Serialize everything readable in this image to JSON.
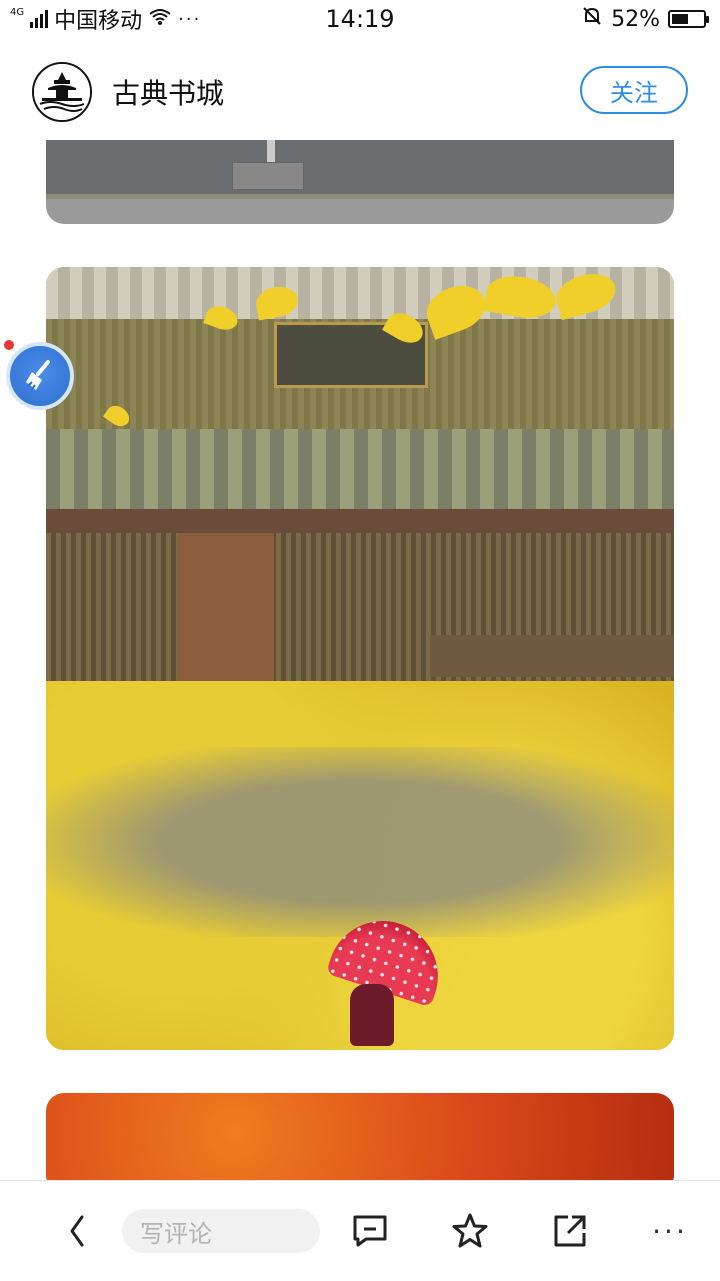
{
  "status_bar": {
    "network_type": "4G",
    "carrier": "中国移动",
    "time": "14:19",
    "battery_percent": "52%",
    "battery_level": 0.52,
    "more_dots": "···"
  },
  "header": {
    "channel_name": "古典书城",
    "follow_label": "关注"
  },
  "bottom_bar": {
    "comment_placeholder": "写评论",
    "more_label": "···"
  },
  "colors": {
    "accent": "#2f8de4",
    "badge": "#2f6fcf",
    "ginkgo_yellow": "#d9b324",
    "umbrella_red": "#e83a53"
  },
  "icons": [
    "signal-bars-icon",
    "wifi-icon",
    "bell-off-icon",
    "battery-icon",
    "broom-icon",
    "back-chevron-icon",
    "comment-icon",
    "star-icon",
    "share-icon",
    "more-icon"
  ]
}
